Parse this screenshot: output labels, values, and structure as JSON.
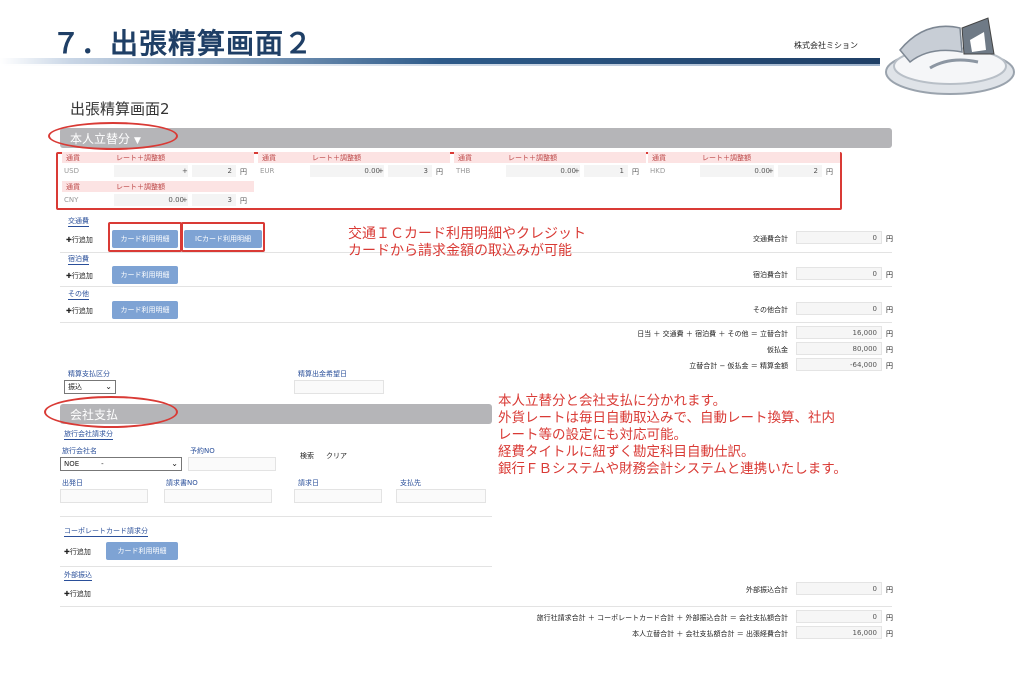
{
  "slide": {
    "title": "７．出張精算画面２",
    "company": "株式会社ミション"
  },
  "screen": {
    "title": "出張精算画面2"
  },
  "personal": {
    "bar_label": "本人立替分",
    "caret": "▼",
    "currency_header_label": "通貨",
    "rate_header_label": "レート＋調整額",
    "currencies": [
      {
        "code": "USD",
        "rate": "",
        "adjust": "2",
        "yen": "円"
      },
      {
        "code": "EUR",
        "rate": "0.00",
        "adjust": "3",
        "yen": "円"
      },
      {
        "code": "THB",
        "rate": "0.00",
        "adjust": "1",
        "yen": "円"
      },
      {
        "code": "HKD",
        "rate": "0.00",
        "adjust": "2",
        "yen": "円"
      },
      {
        "code": "CNY",
        "rate": "0.00",
        "adjust": "3",
        "yen": "円"
      }
    ],
    "plus": "+",
    "transport_label": "交通費",
    "lodging_label": "宿泊費",
    "other_label": "その他",
    "add_row": "✚行追加",
    "card_button": "カード利用明細",
    "ic_button": "ICカード利用明細",
    "transport_total_label": "交通費合計",
    "lodging_total_label": "宿泊費合計",
    "other_total_label": "その他合計",
    "total_formula": "日当 ＋ 交通費 ＋ 宿泊費 ＋ その他 ＝ 立替合計",
    "advance_label": "仮払金",
    "settle_formula": "立替合計 − 仮払金 ＝ 精算金額",
    "transport_total": "0",
    "lodging_total": "0",
    "other_total": "0",
    "sum_total": "16,000",
    "advance": "80,000",
    "settlement": "-64,000",
    "yen": "円",
    "payment_type_label": "精算支払区分",
    "payment_type_value": "振込",
    "desired_date_label": "精算出金希望日"
  },
  "company_pay": {
    "bar_label": "会社支払",
    "agency_section_label": "旅行会社請求分",
    "agency_name_label": "旅行会社名",
    "agency_value": "NOE",
    "agency_dash": "-",
    "reservation_label": "予約NO",
    "search_label": "検索",
    "clear_label": "クリア",
    "departure_label": "出発日",
    "invoice_label": "請求書NO",
    "billing_date_label": "請求日",
    "payee_label": "支払先",
    "corporate_card_label": "コーポレートカード請求分",
    "add_row": "✚行追加",
    "card_button": "カード利用明細",
    "external_label": "外部振込",
    "external_total_label": "外部振込合計",
    "external_total": "0",
    "company_formula": "旅行社請求合計 ＋ コーポレートカード合計 ＋ 外部振込合計 ＝ 会社支払額合計",
    "company_total": "0",
    "grand_formula": "本人立替合計 ＋ 会社支払額合計 ＝ 出張経費合計",
    "grand_total": "16,000",
    "yen": "円"
  },
  "annotations": {
    "card_note": "交通ＩＣカード利用明細やクレジット\nカードから請求金額の取込みが可能",
    "feature_note": "本人立替分と会社支払に分かれます。\n外貨レートは毎日自動取込みで、自動レート換算、社内\nレート等の設定にも対応可能。\n経費タイトルに紐ずく勘定科目自動仕訳。\n銀行ＦＢシステムや財務会計システムと連携いたします。"
  },
  "colors": {
    "title": "#1f3f66",
    "annotation": "#d93a35",
    "button": "#7ea3d4",
    "section_bar": "#b5b5b8"
  }
}
